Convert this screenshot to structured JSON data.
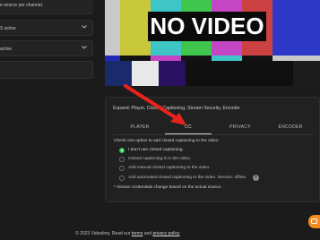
{
  "left_panel": {
    "description": "e source per channel.",
    "rows": [
      {
        "label": "S active",
        "chevron_icon": "chevron-down-icon"
      },
      {
        "label": "active",
        "chevron_icon": "chevron-down-icon"
      },
      {
        "label": ""
      }
    ]
  },
  "video": {
    "overlay_text": "NO VIDEO"
  },
  "settings": {
    "expand_text": "Expand: Player, Closed Captioning, Stream Security, Encoder",
    "tabs": [
      {
        "label": "PLAYER",
        "active": false
      },
      {
        "label": "CC",
        "active": true
      },
      {
        "label": "PRIVACY",
        "active": false
      },
      {
        "label": "ENCODER",
        "active": false
      }
    ],
    "prompt": "Check one option to add closed captioning to the video",
    "options": [
      {
        "label": "I don't use closed captioning.",
        "checked": true
      },
      {
        "label": "Closed captioning is in the video.",
        "checked": false
      },
      {
        "label": "Add manual closed captioning to the video.",
        "checked": false
      },
      {
        "label": "Add automated closed captioning to the video. Service: offline",
        "checked": false
      }
    ],
    "info_icon": "info-icon",
    "note": "* Stream credentials change based on the actual source."
  },
  "footer": {
    "copyright": "© 2023 Videolinq. Read our",
    "terms": "terms",
    "and": "and",
    "privacy": "privacy policy"
  },
  "chat_widget": {
    "icon": "chat-icon"
  },
  "colors": {
    "background": "#1b1b1b",
    "panel": "#212121",
    "accent_green": "#2ec54a",
    "arrow_red": "#e8231c",
    "chat_orange": "#f28b22"
  }
}
